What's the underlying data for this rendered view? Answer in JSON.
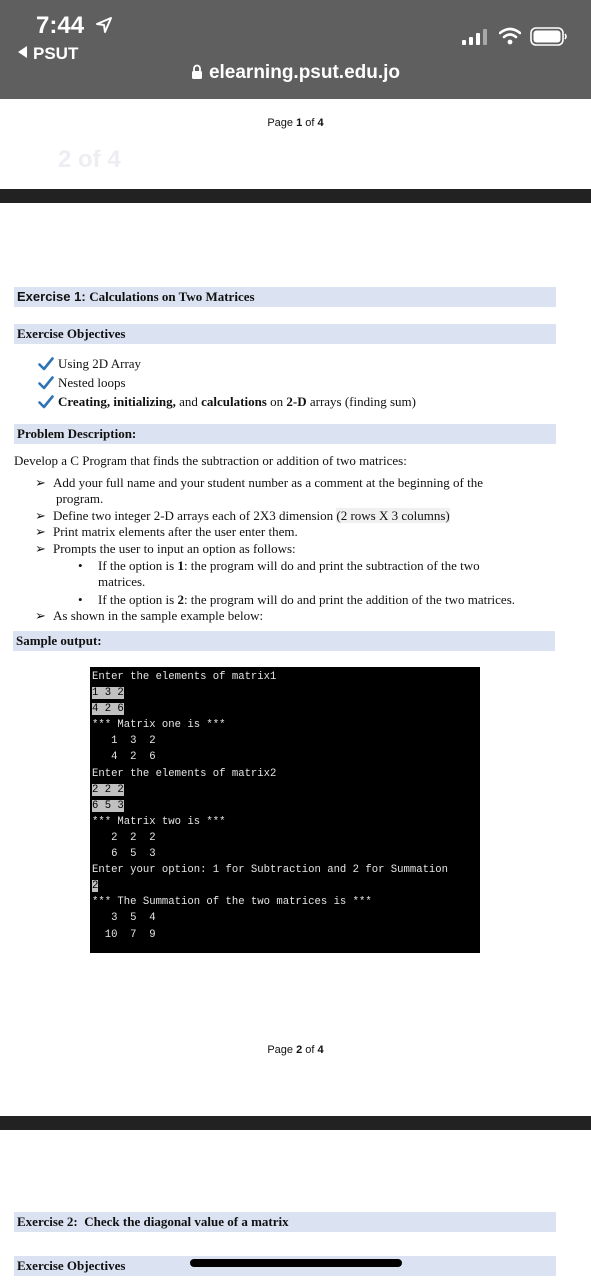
{
  "status_bar": {
    "time": "7:44",
    "back_app": "PSUT"
  },
  "browser": {
    "url": "elearning.psut.edu.jo"
  },
  "doc": {
    "page1": {
      "prefix": "Page ",
      "num": "1",
      "mid": " of ",
      "total": "4"
    },
    "ghost_label": "2 of 4",
    "exercise1": {
      "prefix": "Exercise 1: ",
      "title": "Calculations on Two Matrices"
    },
    "objectives_heading": "Exercise Objectives",
    "objectives": [
      "Using 2D Array",
      "Nested loops",
      {
        "a": "Creating, initializing,",
        "b": " and ",
        "c": "calculations",
        "d": " on ",
        "e": "2-D",
        "f": " arrays (finding sum)"
      }
    ],
    "problem_heading": "Problem Description:",
    "problem_intro": "Develop a C Program that finds the subtraction or addition of two matrices:",
    "steps": [
      {
        "l1": "Add your full name and your student number as a comment at the beginning of the",
        "l2": "program."
      },
      {
        "a": "Define two integer 2-D arrays each of 2X3 dimension ",
        "b": "(2 rows X 3 columns)"
      },
      "Print matrix elements after the user enter them.",
      "Prompts the user to input an option as follows:",
      "As shown in the sample example below:"
    ],
    "options": [
      {
        "a": "If the option is ",
        "b": "1",
        "c": ": the program will do and print the subtraction of the two",
        "l2": "matrices."
      },
      {
        "a": "If the option is ",
        "b": "2",
        "c": ": the program will do and print the addition of the two matrices."
      }
    ],
    "sample_heading": "Sample output:",
    "console_lines": [
      "Enter the elements of matrix1",
      "1 3 2",
      "4 2 6",
      "*** Matrix one is ***",
      "   1  3  2",
      "   4  2  6",
      "Enter the elements of matrix2",
      "2 2 2",
      "6 5 3",
      "*** Matrix two is ***",
      "   2  2  2",
      "   6  5  3",
      "Enter your option: 1 for Subtraction and 2 for Summation",
      "2",
      "*** The Summation of the two matrices is ***",
      "   3  5  4",
      "  10  7  9"
    ],
    "page2": {
      "prefix": "Page ",
      "num": "2",
      "mid": " of ",
      "total": "4"
    },
    "exercise2": "Exercise 2:  Check the diagonal value of a matrix",
    "objectives2_heading": "Exercise Objectives"
  },
  "colors": {
    "heading_band": "#dbe3f3",
    "check": "#2e74b5",
    "topbar": "#5f5f5f"
  }
}
